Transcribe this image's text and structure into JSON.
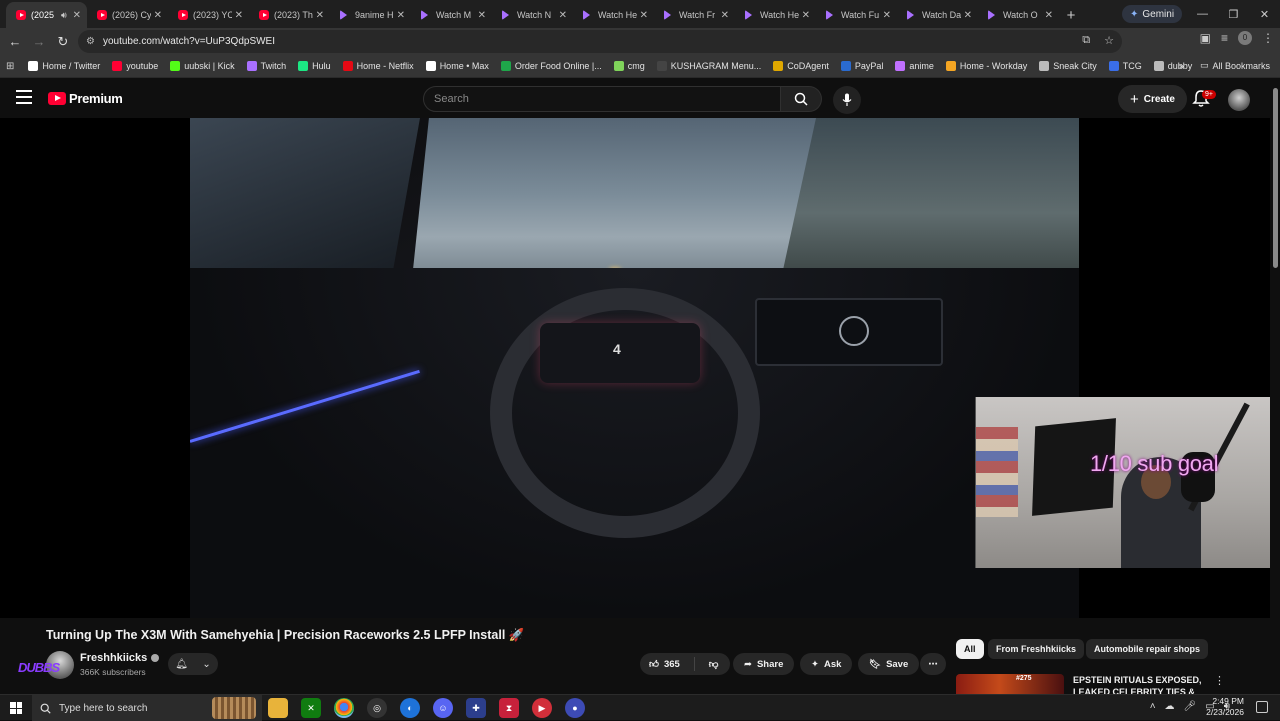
{
  "browser": {
    "tabs": [
      {
        "title": "(2025",
        "favicon": "youtube-icon",
        "active": true
      },
      {
        "title": "(2026) Cy",
        "favicon": "youtube-icon"
      },
      {
        "title": "(2023) YC",
        "favicon": "youtube-icon"
      },
      {
        "title": "(2023) Th",
        "favicon": "youtube-icon"
      },
      {
        "title": "9anime H",
        "favicon": "play-icon"
      },
      {
        "title": "Watch M",
        "favicon": "play-icon"
      },
      {
        "title": "Watch N",
        "favicon": "play-icon"
      },
      {
        "title": "Watch He",
        "favicon": "play-icon"
      },
      {
        "title": "Watch Fr",
        "favicon": "play-icon"
      },
      {
        "title": "Watch He",
        "favicon": "play-icon"
      },
      {
        "title": "Watch Fu",
        "favicon": "play-icon"
      },
      {
        "title": "Watch Da",
        "favicon": "play-icon"
      },
      {
        "title": "Watch O",
        "favicon": "play-icon"
      }
    ],
    "gemini_label": "Gemini",
    "url": "youtube.com/watch?v=UuP3QdpSWEI",
    "profile_initial": "0",
    "bookmarks": [
      {
        "label": "Home / Twitter",
        "color": "#ffffff"
      },
      {
        "label": "youtube",
        "color": "#ff0033"
      },
      {
        "label": "uubski | Kick",
        "color": "#53fc18"
      },
      {
        "label": "Twitch",
        "color": "#a970ff"
      },
      {
        "label": "Hulu",
        "color": "#1ce783"
      },
      {
        "label": "Home - Netflix",
        "color": "#e50914"
      },
      {
        "label": "Home • Max",
        "color": "#ffffff"
      },
      {
        "label": "Order Food Online |...",
        "color": "#1fa64a"
      },
      {
        "label": "cmg",
        "color": "#7fd35a"
      },
      {
        "label": "KUSHAGRAM Menu...",
        "color": "#444444"
      },
      {
        "label": "CoDAgent",
        "color": "#e0a800"
      },
      {
        "label": "PayPal",
        "color": "#2a6bd0"
      },
      {
        "label": "anime",
        "color": "#c070ff"
      },
      {
        "label": "Home - Workday",
        "color": "#f5a623"
      },
      {
        "label": "Sneak City",
        "color": "#bbbbbb"
      },
      {
        "label": "TCG",
        "color": "#3a6ee8"
      },
      {
        "label": "dubby",
        "color": "#bbbbbb"
      }
    ],
    "all_bookmarks_label": "All Bookmarks"
  },
  "youtube": {
    "logo_text": "Premium",
    "search_placeholder": "Search",
    "create_label": "Create",
    "notification_badge": "9+",
    "overlay_text": "1/10 sub goal",
    "video_title": "Turning Up The X3M With Samehyehia | Precision Raceworks 2.5 LPFP Install 🚀",
    "channel_name": "Freshhkiicks",
    "channel_art_text": "DUBBS",
    "subscribers": "366K subscribers",
    "likes": "365",
    "share_label": "Share",
    "ask_label": "Ask",
    "save_label": "Save",
    "chips": [
      "All",
      "From Freshhkiicks",
      "Automobile repair shops"
    ],
    "rec_thumb_text": "#275",
    "rec_title": "EPSTEIN RITUALS EXPOSED, LEAKED CELEBRITY TIES & TH"
  },
  "taskbar": {
    "search_placeholder": "Type here to search",
    "time": "2:49 PM",
    "date": "2/23/2026"
  }
}
